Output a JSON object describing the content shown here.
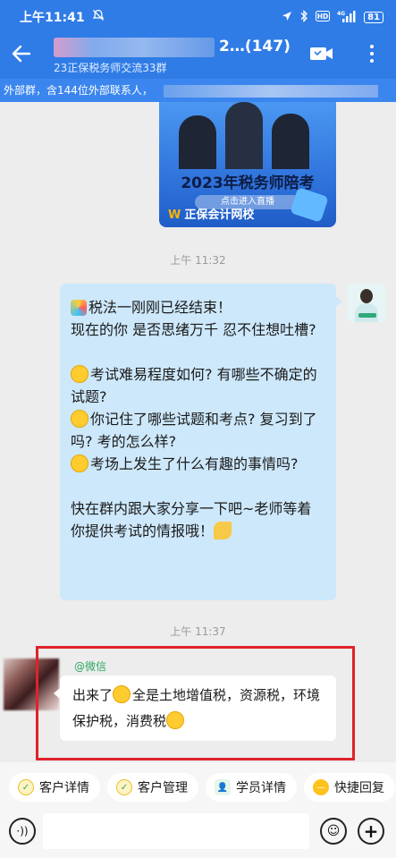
{
  "status_bar": {
    "time": "上午11:41",
    "battery": "81"
  },
  "header": {
    "title": "2…(147)",
    "subtitle": "23正保税务师交流33群",
    "external_notice": "外部群，含144位外部联系人，"
  },
  "promo_card": {
    "title": "2023年税务师陪考",
    "button": "点击进入直播",
    "brand": "正保会计网校"
  },
  "timestamps": [
    "上午 11:32",
    "上午 11:37"
  ],
  "messages": {
    "teacher": {
      "line1": "税法一刚刚已经结束！",
      "line2": "现在的你  是否思绪万千  忍不住想吐槽?",
      "line3": "考试难易程度如何? 有哪些不确定的试题?",
      "line4": "你记住了哪些试题和考点? 复习到了吗? 考的怎么样?",
      "line5": "考场上发生了什么有趣的事情吗?",
      "line6": "快在群内跟大家分享一下吧~老师等着你提供考试的情报哦！"
    },
    "student": {
      "sender": "@微信",
      "part1": "出来了",
      "part2": "全是土地增值税，资源税，环境保护税，消费税"
    }
  },
  "quick_actions": [
    "客户详情",
    "客户管理",
    "学员详情",
    "快捷回复"
  ],
  "input": {
    "placeholder": ""
  },
  "colors": {
    "header_blue": "#2f7ce6",
    "self_bubble": "#cde8fb",
    "highlight_red": "#e0222a",
    "sender_green": "#2ea860"
  }
}
